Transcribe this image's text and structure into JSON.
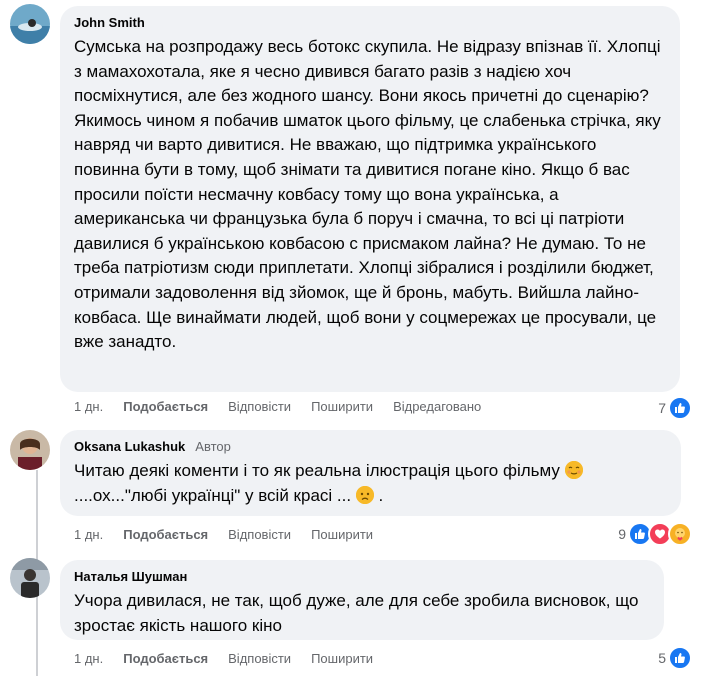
{
  "comments": [
    {
      "author": "John Smith",
      "badge": "",
      "text": "Сумська на розпродажу весь ботокс скупила. Не відразу впізнав її. Хлопці з мамахохотала, яке я чесно дивився багато разів з надією хоч посміхнутися, але без жодного шансу. Вони якось причетні до сценарію? Якимось чином я побачив шматок цього фільму, це слабенька стрічка, яку навряд чи варто дивитися. Не вважаю, що підтримка українського повинна бути в тому, щоб знімати та дивитися погане кіно. Якщо б вас просили поїсти несмачну ковбасу тому що вона українська, а американська чи французька була б поруч і смачна, то всі ці патріоти давилися б українською ковбасою с присмаком лайна? Не думаю. То не треба патріотизм сюди приплетати. Хлопці зібралися і розділили бюджет, отримали задоволення від зйомок, ще й бронь, мабуть. Вийшла лайно-ковбаса. Ще винаймати людей, щоб вони у соцмережах це просували, це вже занадто.",
      "time": "1 дн.",
      "like": "Подобається",
      "reply": "Відповісти",
      "share": "Поширити",
      "edited": "Відредаговано",
      "reaction_count": "7"
    },
    {
      "author": "Oksana Lukashuk",
      "badge": "Автор",
      "text_part1": "Читаю деякі коменти і то як реальна ілюстрація цього фільму",
      "text_part2": "....ох...\"любі українці\" у всій красі ...",
      "text_part3": ".",
      "time": "1 дн.",
      "like": "Подобається",
      "reply": "Відповісти",
      "share": "Поширити",
      "reaction_count": "9"
    },
    {
      "author": "Наталья Шушман",
      "badge": "",
      "text": "Учора дивилася, не так, щоб дуже, але для себе зробила висновок, що зростає якість нашого кіно",
      "time": "1 дн.",
      "like": "Подобається",
      "reply": "Відповісти",
      "share": "Поширити",
      "reaction_count": "5"
    }
  ],
  "icons": [
    "like-reaction-icon",
    "love-reaction-icon",
    "care-reaction-icon",
    "smirk-emoji-icon",
    "sad-emoji-icon"
  ],
  "colors": {
    "bubble": "#f0f2f5",
    "like_blue": "#1877f2",
    "love_red": "#f33e58",
    "meta_gray": "#65676b"
  }
}
